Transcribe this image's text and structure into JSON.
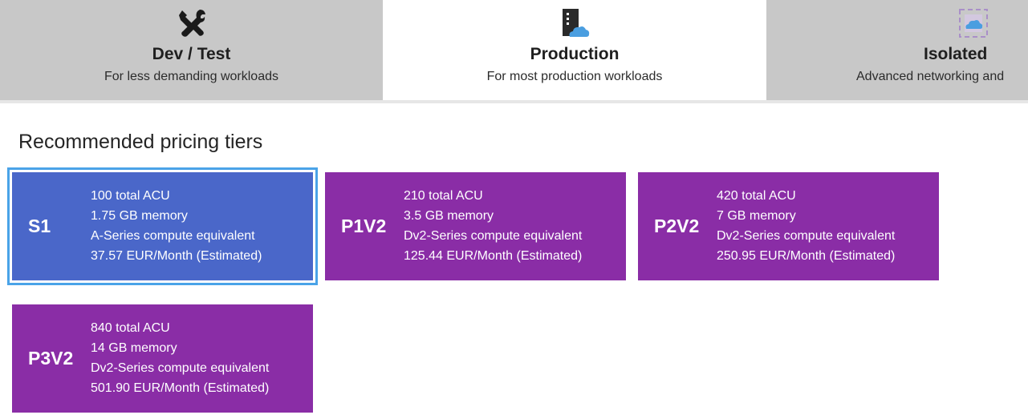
{
  "tabs": [
    {
      "title": "Dev / Test",
      "subtitle": "For less demanding workloads",
      "icon": "tools-icon",
      "active": false
    },
    {
      "title": "Production",
      "subtitle": "For most production workloads",
      "icon": "server-cloud-icon",
      "active": true
    },
    {
      "title": "Isolated",
      "subtitle": "Advanced networking and",
      "icon": "isolated-network-icon",
      "active": false
    }
  ],
  "section": {
    "heading": "Recommended pricing tiers"
  },
  "tiers": [
    {
      "name": "S1",
      "acu": "100 total ACU",
      "memory": "1.75 GB memory",
      "compute": "A-Series compute equivalent",
      "price": "37.57 EUR/Month (Estimated)",
      "color": "#4a67c9",
      "selected": true
    },
    {
      "name": "P1V2",
      "acu": "210 total ACU",
      "memory": "3.5 GB memory",
      "compute": "Dv2-Series compute equivalent",
      "price": "125.44 EUR/Month (Estimated)",
      "color": "#8a2da6",
      "selected": false
    },
    {
      "name": "P2V2",
      "acu": "420 total ACU",
      "memory": "7 GB memory",
      "compute": "Dv2-Series compute equivalent",
      "price": "250.95 EUR/Month (Estimated)",
      "color": "#8a2da6",
      "selected": false
    },
    {
      "name": "P3V2",
      "acu": "840 total ACU",
      "memory": "14 GB memory",
      "compute": "Dv2-Series compute equivalent",
      "price": "501.90 EUR/Month (Estimated)",
      "color": "#8a2da6",
      "selected": false
    }
  ]
}
